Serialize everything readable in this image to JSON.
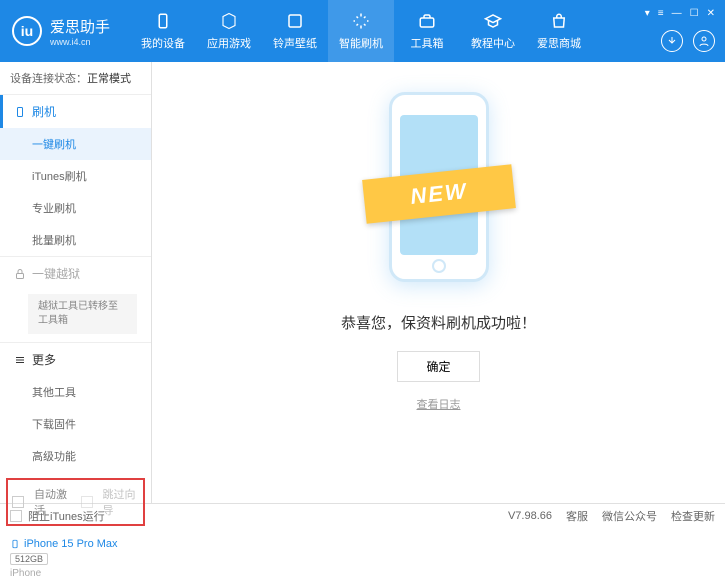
{
  "header": {
    "logo_text": "爱思助手",
    "logo_url": "www.i4.cn",
    "nav": [
      {
        "label": "我的设备"
      },
      {
        "label": "应用游戏"
      },
      {
        "label": "铃声壁纸"
      },
      {
        "label": "智能刷机"
      },
      {
        "label": "工具箱"
      },
      {
        "label": "教程中心"
      },
      {
        "label": "爱思商城"
      }
    ]
  },
  "sidebar": {
    "status_label": "设备连接状态：",
    "status_value": "正常模式",
    "flash": {
      "title": "刷机",
      "items": [
        "一键刷机",
        "iTunes刷机",
        "专业刷机",
        "批量刷机"
      ]
    },
    "jailbreak": {
      "title": "一键越狱",
      "note": "越狱工具已转移至工具箱"
    },
    "more": {
      "title": "更多",
      "items": [
        "其他工具",
        "下载固件",
        "高级功能"
      ]
    },
    "checkboxes": {
      "auto_activate": "自动激活",
      "skip_guide": "跳过向导"
    },
    "device": {
      "name": "iPhone 15 Pro Max",
      "storage": "512GB",
      "type": "iPhone"
    }
  },
  "main": {
    "banner": "NEW",
    "success": "恭喜您，保资料刷机成功啦！",
    "ok": "确定",
    "log": "查看日志"
  },
  "footer": {
    "block_itunes": "阻止iTunes运行",
    "version": "V7.98.66",
    "links": [
      "客服",
      "微信公众号",
      "检查更新"
    ]
  }
}
